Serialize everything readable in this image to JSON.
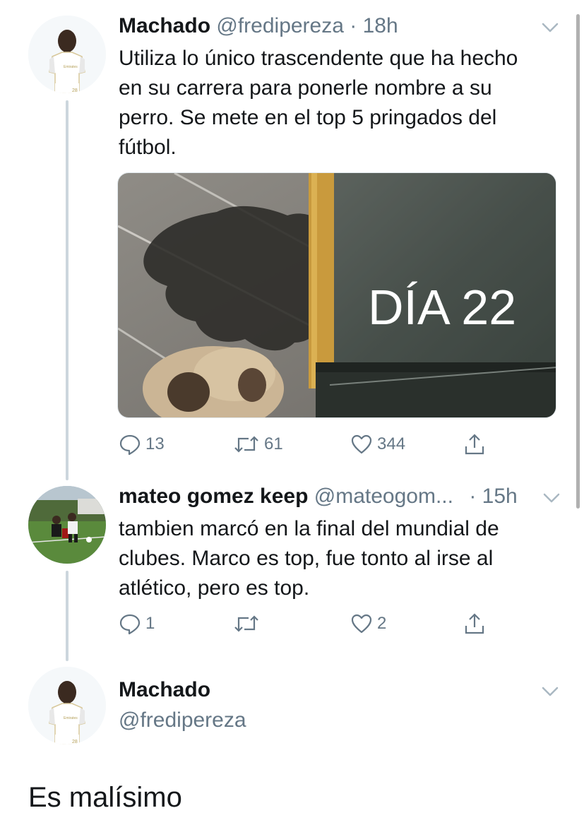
{
  "tweets": [
    {
      "name": "Machado",
      "handle": "@fredipereza",
      "time": "· 18h",
      "text": "Utiliza lo único trascendente que ha hecho en su carrera para ponerle nombre a su perro. Se mete en el top 5 pringados del fútbol.",
      "text_lines": [
        "Utiliza lo único trascendente que ha hecho",
        "en su carrera para ponerle nombre a su",
        "perro. Se mete en el top 5 pringados del",
        "fútbol."
      ],
      "media": {
        "overlay_text": "DÍA 22"
      },
      "replies": "13",
      "retweets": "61",
      "likes": "344"
    },
    {
      "name": "mateo gomez keep",
      "handle": "@mateogom...",
      "time": "· 15h",
      "text_lines": [
        "tambien marcó en la final del mundial de",
        "clubes. Marco es top, fue tonto al irse al",
        "atlético, pero es top."
      ],
      "replies": "1",
      "retweets": "",
      "likes": "2"
    },
    {
      "name": "Machado",
      "handle": "@fredipereza",
      "text": "Es malísimo"
    }
  ],
  "icons": {
    "reply": "reply-icon",
    "retweet": "retweet-icon",
    "like": "heart-icon",
    "share": "share-icon",
    "more": "chevron-down-icon"
  },
  "colors": {
    "text": "#14171a",
    "secondary": "#657786",
    "thread_line": "#ccd6dd"
  }
}
